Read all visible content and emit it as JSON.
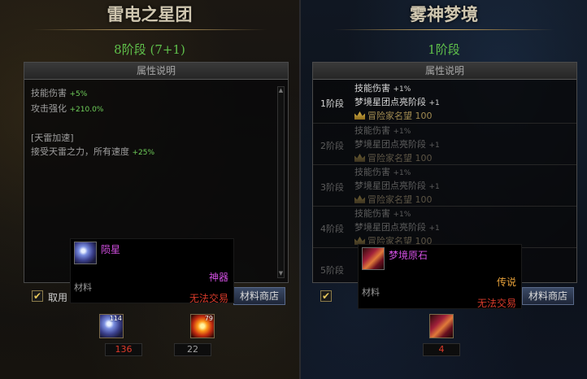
{
  "left": {
    "title": "雷电之星团",
    "stage": "8阶段 (7+1)",
    "box_header": "属性说明",
    "attributes": [
      {
        "label": "技能伤害",
        "value": "+5%"
      },
      {
        "label": "攻击强化",
        "value": "+210.0%"
      }
    ],
    "special_title": "[天雷加速]",
    "special_line": {
      "label": "接受天雷之力，所有速度",
      "value": "+25%"
    },
    "use_material_label": "取用",
    "shop_button": "材料商店",
    "tooltip": {
      "name": "陨星",
      "rarity": "神器",
      "type": "材料",
      "trade": "无法交易",
      "name_color": "#d14fe0",
      "rarity_color": "#d14fe0"
    },
    "materials": [
      {
        "icon": "meteor-orb-icon",
        "badge": "114",
        "count": "136",
        "count_color": "red"
      },
      {
        "icon": "thunder-essence-icon",
        "badge": "79",
        "count": "22",
        "count_color": "gray"
      }
    ]
  },
  "right": {
    "title": "雾神梦境",
    "stage": "1阶段",
    "box_header": "属性说明",
    "stages": [
      {
        "label": "1阶段",
        "lines": [
          {
            "t": "技能伤害",
            "v": "+1%"
          },
          {
            "t": "梦境星团点亮阶段",
            "v": "+1"
          }
        ],
        "rep": "冒险家名望",
        "rep_value": "100",
        "state": "active"
      },
      {
        "label": "2阶段",
        "lines": [
          {
            "t": "技能伤害",
            "v": "+1%"
          },
          {
            "t": "梦境星团点亮阶段",
            "v": "+1"
          }
        ],
        "rep": "冒险家名望",
        "rep_value": "100",
        "state": "dim"
      },
      {
        "label": "3阶段",
        "lines": [
          {
            "t": "技能伤害",
            "v": "+1%"
          },
          {
            "t": "梦境星团点亮阶段",
            "v": "+1"
          }
        ],
        "rep": "冒险家名望",
        "rep_value": "100",
        "state": "dim"
      },
      {
        "label": "4阶段",
        "lines": [
          {
            "t": "技能伤害",
            "v": "+1%"
          },
          {
            "t": "梦境星团点亮阶段",
            "v": "+1"
          }
        ],
        "rep": "冒险家名望",
        "rep_value": "100",
        "state": "dim"
      },
      {
        "label": "5阶段",
        "state": "dim"
      }
    ],
    "shop_button": "材料商店",
    "tooltip": {
      "name": "梦境原石",
      "rarity": "传说",
      "type": "材料",
      "trade": "无法交易",
      "name_color": "#d14fe0",
      "rarity_color": "#e8a23a"
    },
    "materials": [
      {
        "icon": "dream-ore-icon",
        "count": "4",
        "count_color": "red"
      }
    ]
  }
}
